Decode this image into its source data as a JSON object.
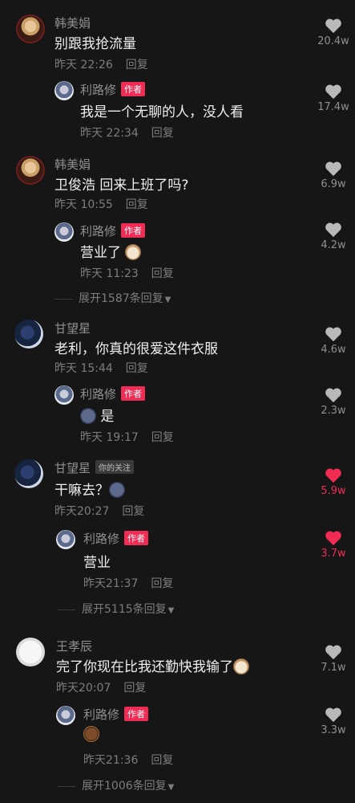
{
  "author_badge": "作者",
  "follow_badge": "你的关注",
  "reply_label": "回复",
  "colors": {
    "accent": "#f02c55",
    "background": "#161616",
    "text": "#efefef",
    "muted": "#8f8f8f"
  },
  "threads": [
    {
      "name": "韩美娟",
      "text": "别跟我抢流量",
      "time": "昨天 22:26",
      "likes": "20.4w",
      "reply": {
        "name": "利路修",
        "text": "我是一个无聊的人，没人看",
        "time": "昨天 22:34",
        "likes": "17.4w"
      }
    },
    {
      "name": "韩美娟",
      "text": "卫俊浩 回来上班了吗?",
      "time": "昨天 10:55",
      "likes": "6.9w",
      "reply": {
        "name": "利路修",
        "text": "营业了",
        "time": "昨天 11:23",
        "likes": "4.2w"
      },
      "expand": "展开1587条回复"
    },
    {
      "name": "甘望星",
      "text": "老利，你真的很爱这件衣服",
      "time": "昨天 15:44",
      "likes": "4.6w",
      "reply": {
        "name": "利路修",
        "text": "是",
        "time": "昨天 19:17",
        "likes": "2.3w"
      }
    },
    {
      "name": "甘望星",
      "text": "干嘛去？",
      "time": "昨天20:27",
      "likes": "5.9w",
      "liked": true,
      "reply": {
        "name": "利路修",
        "text": "营业",
        "time": "昨天21:37",
        "likes": "3.7w",
        "liked": true
      },
      "expand": "展开5115条回复"
    },
    {
      "name": "王孝辰",
      "text": "完了你现在比我还勤快我输了",
      "time": "昨天20:07",
      "likes": "7.1w",
      "reply": {
        "name": "利路修",
        "text": "",
        "time": "昨天21:36",
        "likes": "3.3w"
      },
      "expand": "展开1006条回复"
    }
  ]
}
